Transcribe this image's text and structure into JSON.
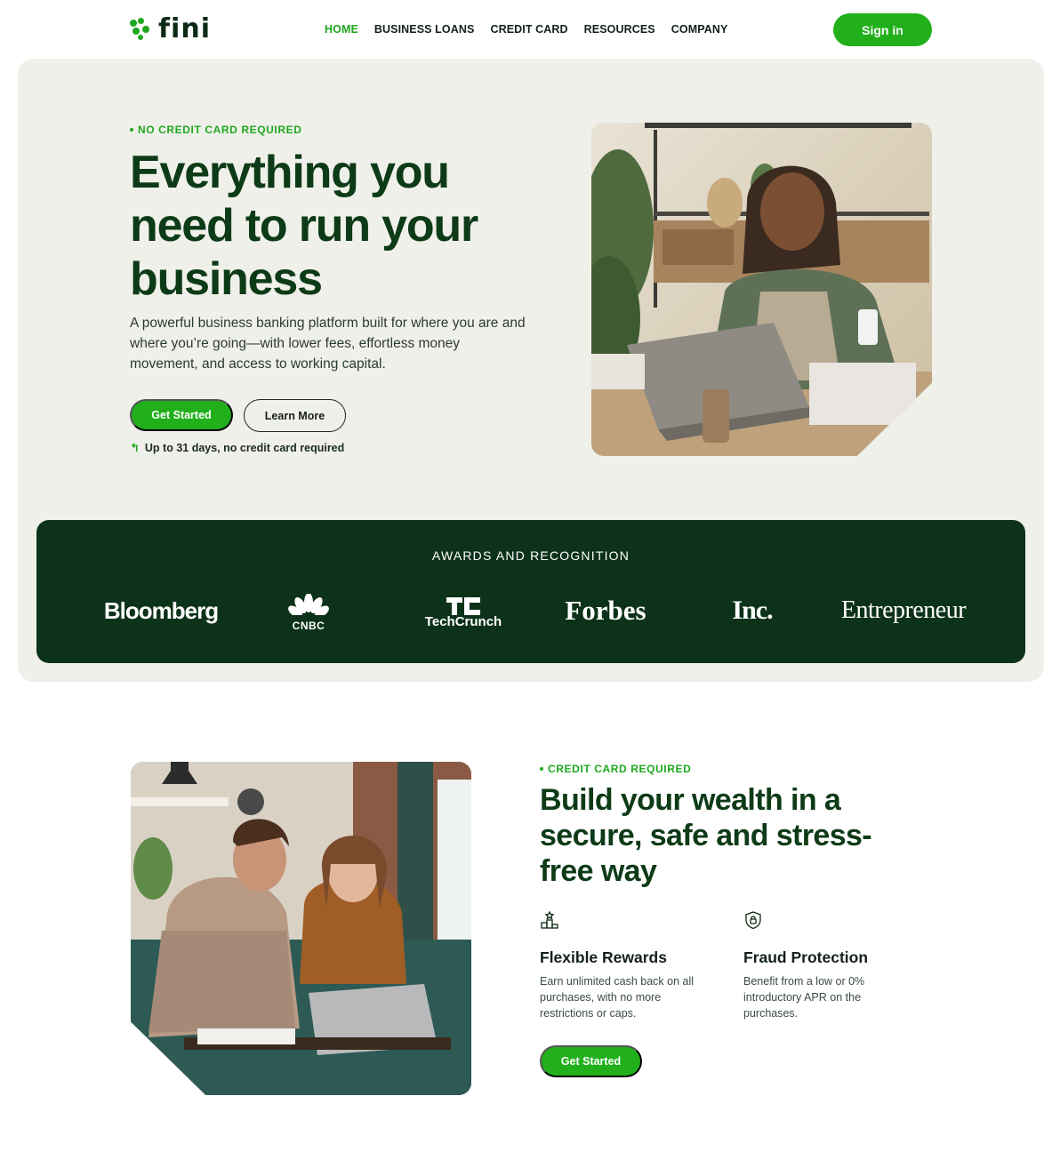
{
  "nav": {
    "logo": "fini",
    "links": [
      "HOME",
      "BUSINESS LOANS",
      "CREDIT CARD",
      "RESOURCES",
      "COMPANY"
    ],
    "signin": "Sign in"
  },
  "hero": {
    "eyebrow": "NO CREDIT CARD REQUIRED",
    "title": "Everything you need to run your business",
    "description": "A powerful business banking platform built for where you are and where you’re going—with lower fees, effortless money movement, and access to working capital.",
    "primary_cta": "Get Started",
    "secondary_cta": "Learn More",
    "note": "Up to 31 days, no credit card required"
  },
  "awards": {
    "title": "AWARDS AND RECOGNITION",
    "logos": [
      "Bloomberg",
      "CNBC",
      "TechCrunch",
      "Forbes",
      "Inc.",
      "Entrepreneur"
    ]
  },
  "wealth": {
    "eyebrow": "CREDIT CARD REQUIRED",
    "title": "Build your wealth in a secure, safe and stress-free way",
    "features": [
      {
        "icon": "podium-icon",
        "title": "Flexible Rewards",
        "text": "Earn unlimited cash back on all purchases, with no more restrictions or caps."
      },
      {
        "icon": "shield-lock-icon",
        "title": "Fraud Protection",
        "text": "Benefit from a low or 0% introductory APR on the purchases."
      }
    ],
    "cta": "Get Started"
  },
  "colors": {
    "brand_green": "#21b01c",
    "dark_green": "#0d321a",
    "hero_bg": "#f0f0ea"
  }
}
